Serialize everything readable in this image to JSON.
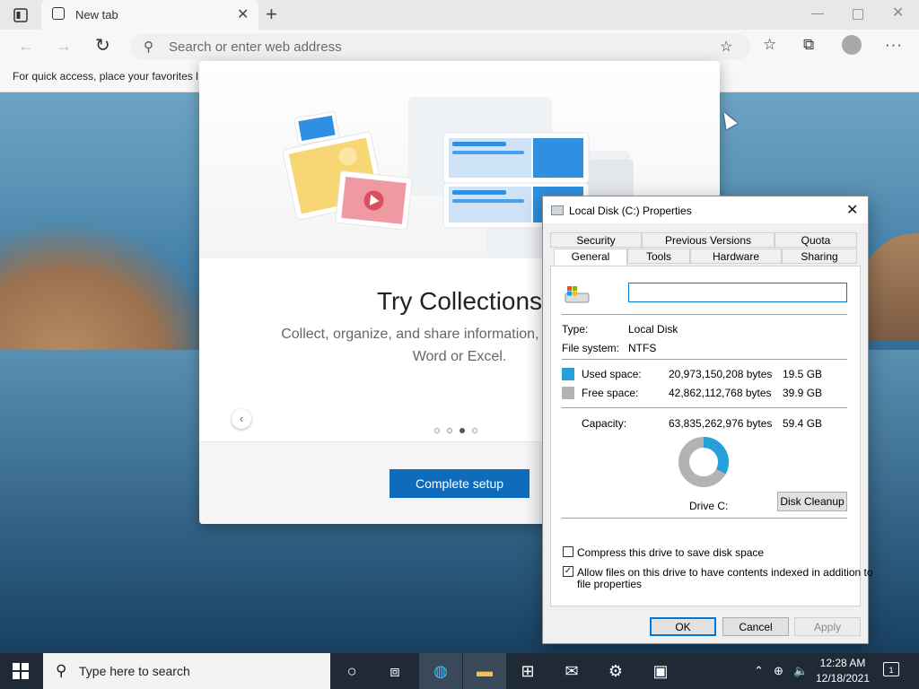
{
  "browser": {
    "tab_title": "New tab",
    "address_placeholder": "Search or enter web address",
    "favorites_bar_text": "For quick access, place your favorites here on the favorites bar."
  },
  "modal": {
    "title": "Try Collections",
    "description_line1": "Collect, organize, and share information, and export it to",
    "description_line2": "Word or Excel.",
    "complete_button": "Complete setup",
    "carousel_current": 3,
    "carousel_total": 4
  },
  "dialog": {
    "title": "Local Disk (C:) Properties",
    "tabs_row_back": [
      "Security",
      "Previous Versions",
      "Quota"
    ],
    "tabs_row_front": [
      "General",
      "Tools",
      "Hardware",
      "Sharing"
    ],
    "active_tab": "General",
    "name_value": "",
    "type_label": "Type:",
    "type_value": "Local Disk",
    "fs_label": "File system:",
    "fs_value": "NTFS",
    "used_label": "Used space:",
    "used_bytes": "20,973,150,208 bytes",
    "used_gb": "19.5 GB",
    "free_label": "Free space:",
    "free_bytes": "42,862,112,768 bytes",
    "free_gb": "39.9 GB",
    "capacity_label": "Capacity:",
    "capacity_bytes": "63,835,262,976 bytes",
    "capacity_gb": "59.4 GB",
    "drive_label": "Drive C:",
    "cleanup_button": "Disk Cleanup",
    "compress_label": "Compress this drive to save disk space",
    "compress_checked": false,
    "index_label_line1": "Allow files on this drive to have contents indexed in addition to",
    "index_label_line2": "file properties",
    "index_checked": true,
    "ok": "OK",
    "cancel": "Cancel",
    "apply": "Apply",
    "used_fraction": 0.3286,
    "colors": {
      "used": "#26a0da",
      "free": "#b3b3b3"
    }
  },
  "taskbar": {
    "search_placeholder": "Type here to search",
    "time": "12:28 AM",
    "date": "12/18/2021",
    "notification_count": "1"
  }
}
